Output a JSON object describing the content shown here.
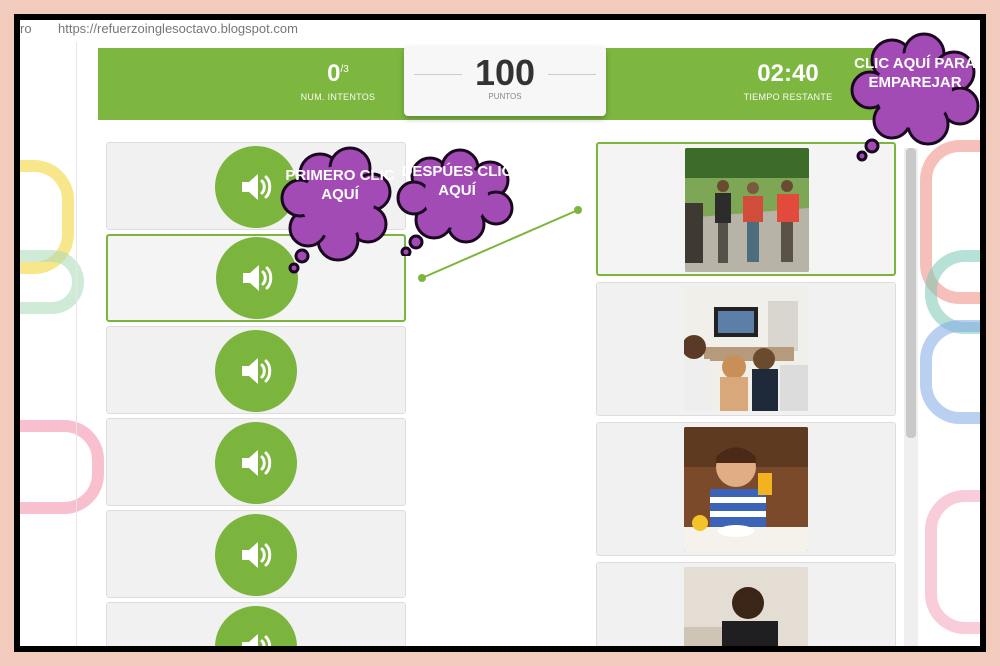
{
  "browser": {
    "url_prefix": "ro",
    "url": "https://refuerzoinglesoctavo.blogspot.com"
  },
  "game": {
    "attempts_value": "0",
    "attempts_total": "/3",
    "attempts_label": "NUM. INTENTOS",
    "points_value": "100",
    "points_label": "PUNTOS",
    "time_value": "02:40",
    "time_label": "TIEMPO RESTANTE"
  },
  "audio_items": [
    {
      "selected": false
    },
    {
      "selected": true
    },
    {
      "selected": false
    },
    {
      "selected": false
    },
    {
      "selected": false
    },
    {
      "selected": false
    }
  ],
  "image_items": [
    {
      "scene": "children-walking-to-school",
      "selected": true
    },
    {
      "scene": "family-watching-tv",
      "selected": false
    },
    {
      "scene": "boy-drinking-juice",
      "selected": false
    },
    {
      "scene": "boy-studying",
      "selected": false
    }
  ],
  "callouts": {
    "first": "PRIMERO CLIC AQUÍ",
    "then": "DESPÚES CLIC AQUÍ",
    "match": "CLIC AQUÍ PARA EMPAREJAR"
  },
  "colors": {
    "accent": "#7db740",
    "callout_fill": "#a24bb4",
    "callout_border": "#1a0820"
  }
}
